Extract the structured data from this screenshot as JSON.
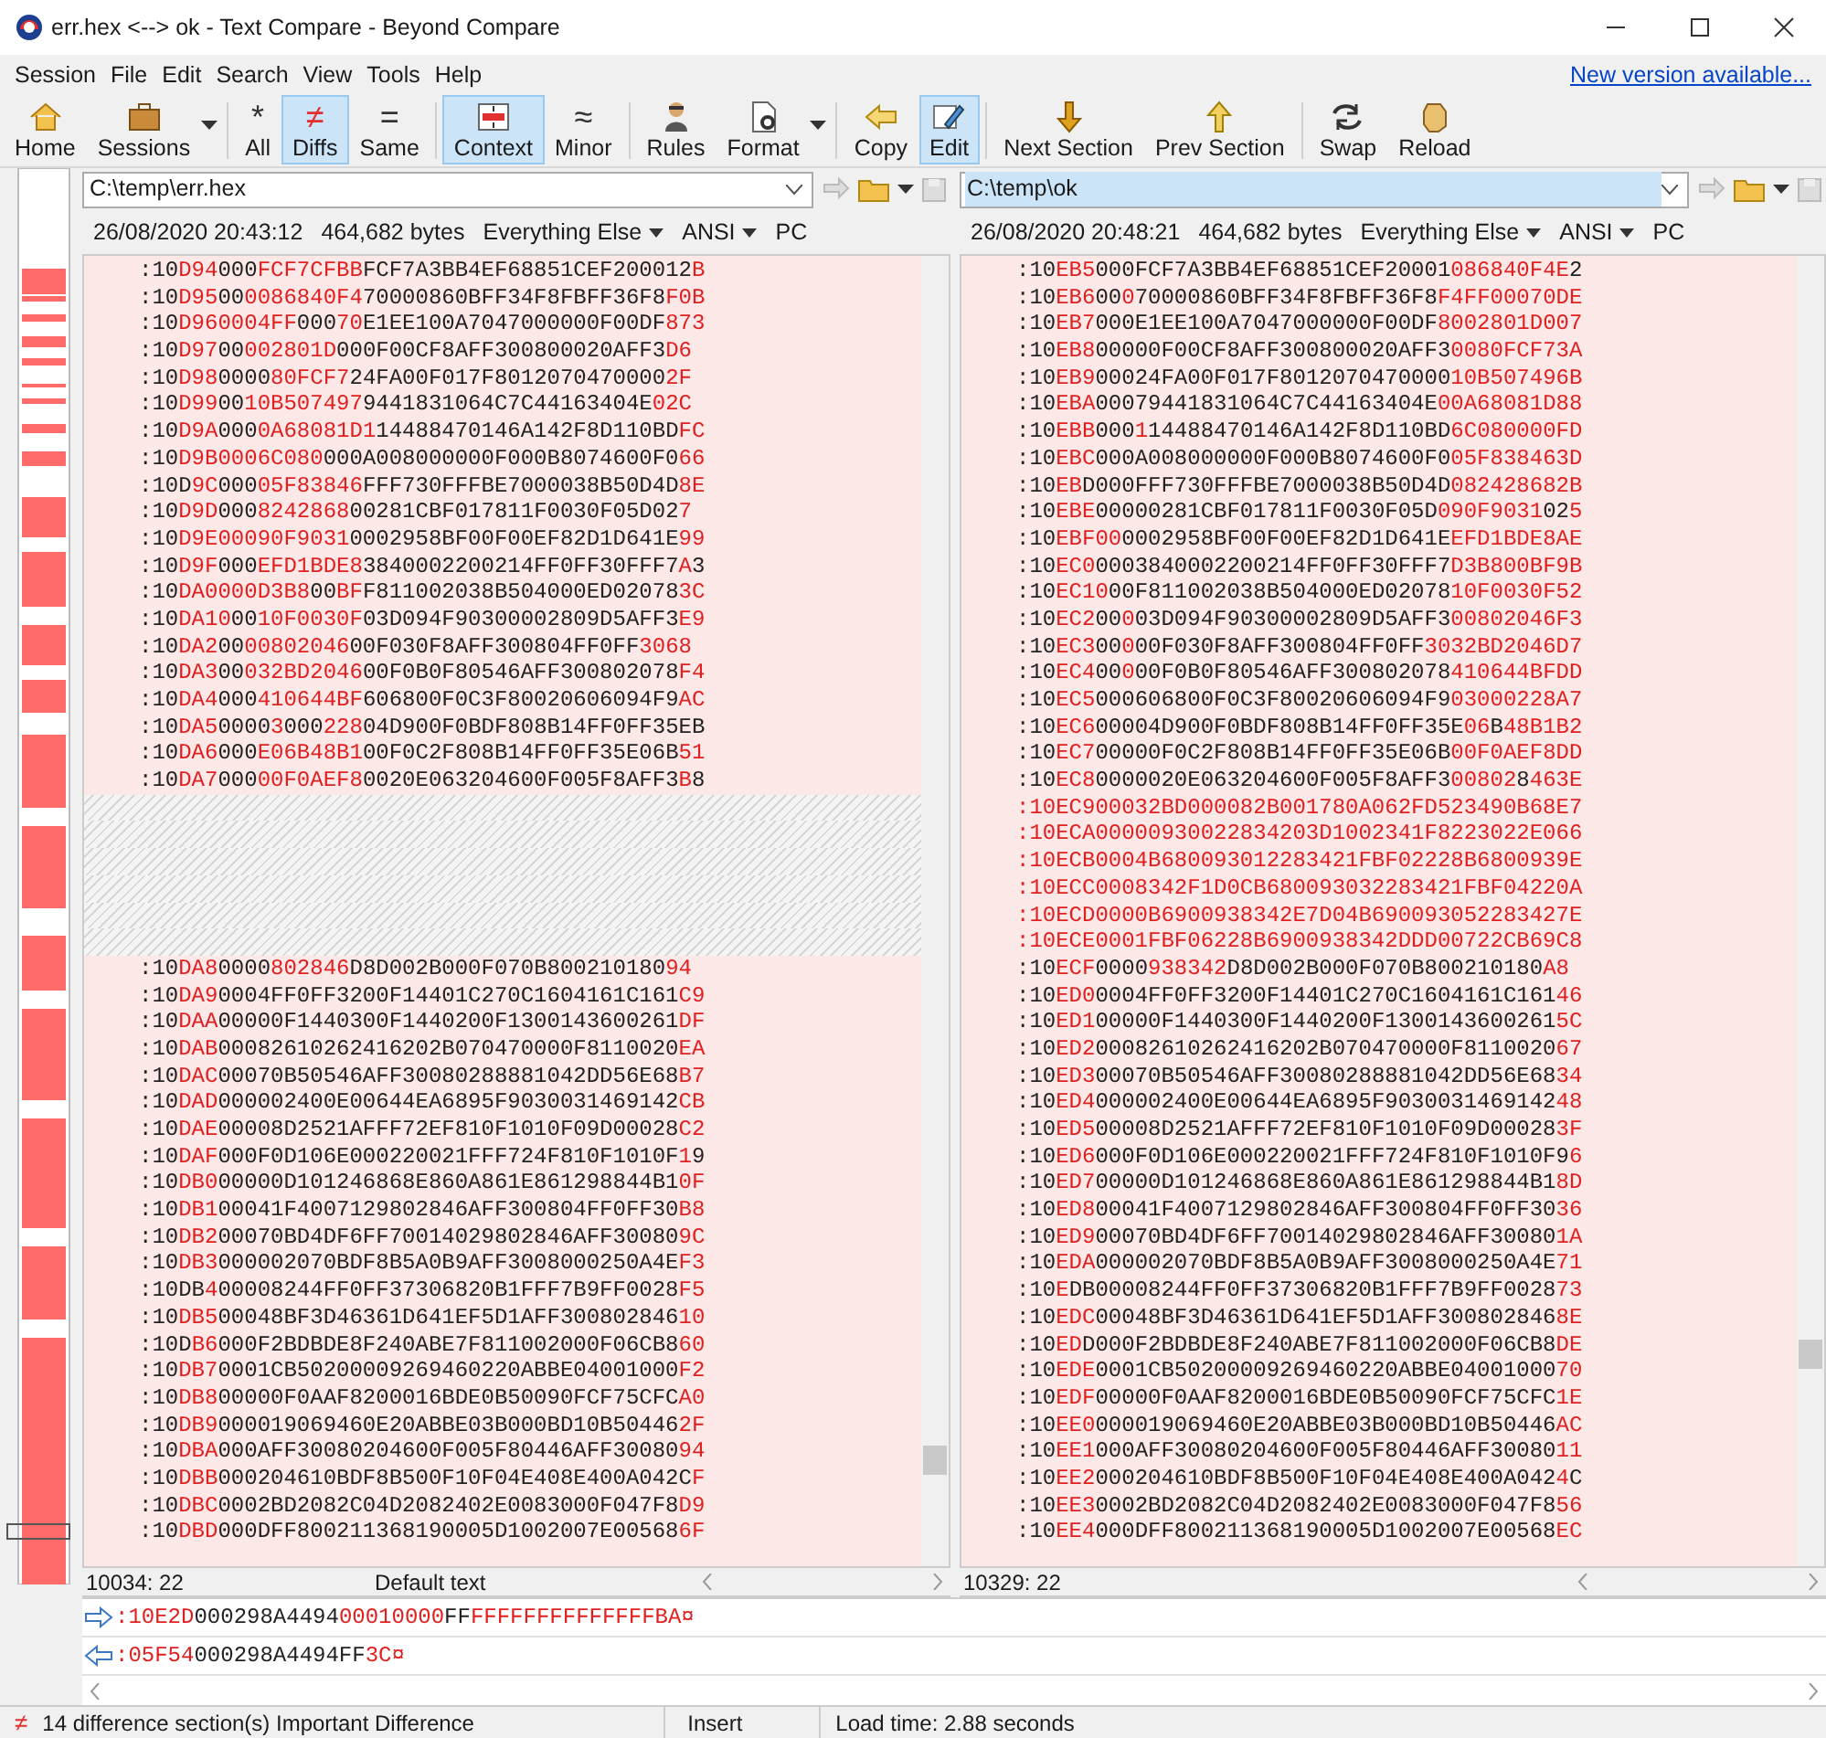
{
  "window": {
    "title": "err.hex <--> ok - Text Compare - Beyond Compare"
  },
  "menu": [
    "Session",
    "File",
    "Edit",
    "Search",
    "View",
    "Tools",
    "Help"
  ],
  "update_link": "New version available...",
  "toolbar": [
    {
      "label": "Home",
      "selected": false,
      "dropdown": false
    },
    {
      "label": "Sessions",
      "selected": false,
      "dropdown": true
    },
    {
      "label": "All",
      "glyph": "*",
      "selected": false,
      "dropdown": false
    },
    {
      "label": "Diffs",
      "glyph": "≠",
      "selected": true,
      "dropdown": false
    },
    {
      "label": "Same",
      "glyph": "=",
      "selected": false,
      "dropdown": false
    },
    {
      "label": "Context",
      "selected": true,
      "dropdown": false
    },
    {
      "label": "Minor",
      "glyph": "≈",
      "selected": false,
      "dropdown": false
    },
    {
      "label": "Rules",
      "selected": false,
      "dropdown": false
    },
    {
      "label": "Format",
      "selected": false,
      "dropdown": true
    },
    {
      "label": "Copy",
      "selected": false,
      "dropdown": false
    },
    {
      "label": "Edit",
      "selected": true,
      "dropdown": false
    },
    {
      "label": "Next Section",
      "selected": false,
      "dropdown": false
    },
    {
      "label": "Prev Section",
      "selected": false,
      "dropdown": false
    },
    {
      "label": "Swap",
      "selected": false,
      "dropdown": false
    },
    {
      "label": "Reload",
      "selected": false,
      "dropdown": false
    }
  ],
  "panes": [
    {
      "path": "C:\\temp\\err.hex",
      "highlighted": false,
      "timestamp": "26/08/2020 20:43:12",
      "size": "464,682 bytes",
      "format": "Everything Else",
      "encoding": "ANSI",
      "line_endings": "PC",
      "position": "10034: 22",
      "mode": "Default text",
      "lines": [
        {
          "kind": "mixed",
          "parts": [
            ":10",
            "D94",
            "000",
            "FCF7CFBB",
            "FCF7A3BB4EF68851CEF200012",
            "B"
          ]
        },
        {
          "kind": "mixed",
          "parts": [
            ":10",
            "D95",
            "00",
            "0086840F4",
            "70000860BFF34F8FBFF36F8",
            "F0B"
          ]
        },
        {
          "kind": "mixed",
          "parts": [
            ":10",
            "D960004FF",
            "000",
            "70",
            "E1EE100A7047000000F00DF",
            "873"
          ]
        },
        {
          "kind": "mixed",
          "parts": [
            ":10",
            "D97",
            "00",
            "002801D",
            "000F00CF8AFF300800020AFF3",
            "D6"
          ]
        },
        {
          "kind": "mixed",
          "parts": [
            ":10",
            "D98",
            "0000",
            "80FCF7",
            "24FA00F017F8012070470000",
            "2F"
          ]
        },
        {
          "kind": "mixed",
          "parts": [
            ":10",
            "D99",
            "00",
            "10B507497",
            "9441831064C7C44163404E",
            "02C"
          ]
        },
        {
          "kind": "mixed",
          "parts": [
            ":10",
            "D9A",
            "000",
            "0A68081D1",
            "14488470146A142F8D110BD",
            "FC"
          ]
        },
        {
          "kind": "mixed",
          "parts": [
            ":10",
            "D9B0006C080",
            "000A008000000F000B8074600F0",
            "66"
          ]
        },
        {
          "kind": "mixed",
          "parts": [
            ":10D",
            "9C",
            "000",
            "05F83846",
            "FFF730FFFBE7000038B50D4D",
            "8E"
          ]
        },
        {
          "kind": "mixed",
          "parts": [
            ":10",
            "D9D",
            "000",
            "8242868",
            "00281CBF017811F0030F05D02",
            "7"
          ]
        },
        {
          "kind": "mixed",
          "parts": [
            ":10",
            "D9E00090F9031",
            "0002958BF00F00EF82D1D641E",
            "99"
          ]
        },
        {
          "kind": "mixed",
          "parts": [
            ":10",
            "D9F",
            "000",
            "EFD1BDE8",
            "3840002200214FF0FF30FFF7",
            "A",
            "3"
          ]
        },
        {
          "kind": "mixed",
          "parts": [
            ":10",
            "DA0000D3B8",
            "00",
            "BF",
            "F811002038B504000ED02078",
            "3C"
          ]
        },
        {
          "kind": "mixed",
          "parts": [
            ":10",
            "DA10",
            "00",
            "10F0030F",
            "03D094F90300002809D5AFF3",
            "E9"
          ]
        },
        {
          "kind": "mixed",
          "parts": [
            ":10",
            "DA2",
            "00",
            "00802046",
            "00F030F8AFF300804FF0FF",
            "3068"
          ]
        },
        {
          "kind": "mixed",
          "parts": [
            ":10",
            "DA3",
            "00",
            "032BD2046",
            "00F0B0F80546AFF300802078",
            "F4"
          ]
        },
        {
          "kind": "mixed",
          "parts": [
            ":10",
            "DA4",
            "000",
            "410644BF",
            "606800F0C3F80020606094F9",
            "AC"
          ]
        },
        {
          "kind": "mixed",
          "parts": [
            ":10",
            "DA5",
            "0000",
            "3",
            "000",
            "228",
            "04D900F0BDF808B14FF0FF35EB"
          ]
        },
        {
          "kind": "mixed",
          "parts": [
            ":10",
            "DA6",
            "000",
            "E06B48B1",
            "00F0C2F808B14FF0FF35E06B",
            "51"
          ]
        },
        {
          "kind": "mixed",
          "parts": [
            ":10",
            "DA7",
            "000",
            "00F0AEF8",
            "0020E063204600F005F8AFF3",
            "B",
            "8"
          ]
        },
        {
          "kind": "missing"
        },
        {
          "kind": "missing"
        },
        {
          "kind": "missing"
        },
        {
          "kind": "missing"
        },
        {
          "kind": "missing"
        },
        {
          "kind": "missing"
        },
        {
          "kind": "mixed",
          "parts": [
            ":10",
            "DA8",
            "0000",
            "802846",
            "D8D002B000F070B800210180",
            "94"
          ]
        },
        {
          "kind": "mixed",
          "parts": [
            ":10",
            "DA9",
            "0004FF0FF3200F14401C270C1604161C161",
            "C9"
          ]
        },
        {
          "kind": "mixed",
          "parts": [
            ":10",
            "DAA",
            "00000F1440300F1440200F1300143600261",
            "DF"
          ]
        },
        {
          "kind": "mixed",
          "parts": [
            ":10",
            "DAB",
            "00082610262416202B070470000F8110020",
            "EA"
          ]
        },
        {
          "kind": "mixed",
          "parts": [
            ":10",
            "DAC",
            "00070B50546AFF30080288881042DD56E68",
            "B7"
          ]
        },
        {
          "kind": "mixed",
          "parts": [
            ":10",
            "DAD",
            "000002400E00644EA6895F9030031469142",
            "CB"
          ]
        },
        {
          "kind": "mixed",
          "parts": [
            ":10",
            "DAE",
            "00008D2521AFFF72EF810F1010F09D00028",
            "C2"
          ]
        },
        {
          "kind": "mixed",
          "parts": [
            ":10",
            "DAF",
            "000F0D106E000220021FFF724F810F1010F",
            "1",
            "9"
          ]
        },
        {
          "kind": "mixed",
          "parts": [
            ":10",
            "DB0",
            "00000D101246868E860A861E861298844B1",
            "0F"
          ]
        },
        {
          "kind": "mixed",
          "parts": [
            ":10",
            "DB1",
            "00041F4007129802846AFF300804FF0FF30",
            "B8"
          ]
        },
        {
          "kind": "mixed",
          "parts": [
            ":10",
            "DB2",
            "00070BD4DF6FF70014029802846AFF30080",
            "9C"
          ]
        },
        {
          "kind": "mixed",
          "parts": [
            ":10",
            "DB3",
            "000002070BDF8B5A0B9AFF3008000250A4E",
            "F3"
          ]
        },
        {
          "kind": "mixed",
          "parts": [
            ":10DB",
            "4",
            "00008244FF0FF37306820B1FFF7B9FF0028",
            "F5"
          ]
        },
        {
          "kind": "mixed",
          "parts": [
            ":10",
            "DB5",
            "00048BF3D46361D641EF5D1AFF300802846",
            "10"
          ]
        },
        {
          "kind": "mixed",
          "parts": [
            ":10D",
            "B6",
            "000F2BDBDE8F240ABE7F811002000F06CB8",
            "60"
          ]
        },
        {
          "kind": "mixed",
          "parts": [
            ":10",
            "DB7",
            "0001CB50200009269460220ABBE04001000",
            "F2"
          ]
        },
        {
          "kind": "mixed",
          "parts": [
            ":10",
            "DB8",
            "00000F0AAF8200016BDE0B50090FCF75CFC",
            "A0"
          ]
        },
        {
          "kind": "mixed",
          "parts": [
            ":10",
            "DB9",
            "000019069460E20ABBE03B000BD10B50446",
            "2F"
          ]
        },
        {
          "kind": "mixed",
          "parts": [
            ":10",
            "DBA",
            "000AFF30080204600F005F80446AFF30080",
            "94"
          ]
        },
        {
          "kind": "mixed",
          "parts": [
            ":10",
            "DBB",
            "000204610BDF8B500F10F04E408E400A042C",
            "F"
          ]
        },
        {
          "kind": "mixed",
          "parts": [
            ":10",
            "DBC",
            "0002BD2082C04D2082402E0083000F047F8",
            "D9"
          ]
        },
        {
          "kind": "mixed",
          "parts": [
            ":10",
            "DBD",
            "000DFF800211368190005D1002007E00568",
            "6F"
          ]
        }
      ]
    },
    {
      "path": "C:\\temp\\ok",
      "highlighted": true,
      "timestamp": "26/08/2020 20:48:21",
      "size": "464,682 bytes",
      "format": "Everything Else",
      "encoding": "ANSI",
      "line_endings": "PC",
      "position": "10329: 22",
      "lines": [
        {
          "kind": "mixed",
          "parts": [
            ":10",
            "EB5",
            "000FCF7A3BB4EF68851CEF20001",
            "086840F4E",
            "2"
          ]
        },
        {
          "kind": "mixed",
          "parts": [
            ":10",
            "EB6",
            "00",
            "0",
            "70000860BFF34F8FBFF36F8",
            "F4FF00070DE"
          ]
        },
        {
          "kind": "mixed",
          "parts": [
            ":10",
            "EB7",
            "000E1EE100A7047000000F00DF",
            "8002801D007"
          ]
        },
        {
          "kind": "mixed",
          "parts": [
            ":10",
            "EB8",
            "00000F00CF8AFF300800020AFF3",
            "0080FCF73A"
          ]
        },
        {
          "kind": "mixed",
          "parts": [
            ":10",
            "EB9",
            "00024FA00F017F8012070470000",
            "10B507496B"
          ]
        },
        {
          "kind": "mixed",
          "parts": [
            ":10",
            "EBA",
            "00079441831064C7C44163404E",
            "00A68081D88"
          ]
        },
        {
          "kind": "mixed",
          "parts": [
            ":10",
            "EBB",
            "000",
            "1",
            "14488470146A142F8D110BD",
            "6C080000FD"
          ]
        },
        {
          "kind": "mixed",
          "parts": [
            ":10",
            "EBC",
            "000A008000000F000B8074600F0",
            "05F838463D"
          ]
        },
        {
          "kind": "mixed",
          "parts": [
            ":10",
            "EB",
            "D000FFF730FFFBE7000038B50D4D",
            "082428682B"
          ]
        },
        {
          "kind": "mixed",
          "parts": [
            ":10",
            "EBE",
            "00000281CBF017811F0030F05D",
            "090F9031",
            "02",
            "5"
          ]
        },
        {
          "kind": "mixed",
          "parts": [
            ":10",
            "EBF00",
            "0002958BF00F00EF82D1D641E",
            "EFD1BDE8AE"
          ]
        },
        {
          "kind": "mixed",
          "parts": [
            ":10",
            "EC0",
            "0003840002200214FF0FF30FFF7",
            "D3B800BF9B"
          ]
        },
        {
          "kind": "mixed",
          "parts": [
            ":10",
            "EC10",
            "00F811002038B504000ED02078",
            "10F0030F52"
          ]
        },
        {
          "kind": "mixed",
          "parts": [
            ":10",
            "EC2",
            "00",
            "0",
            "03D094F90300002809D5AFF3",
            "00802046F3"
          ]
        },
        {
          "kind": "mixed",
          "parts": [
            ":10",
            "EC3",
            "00",
            "0",
            "00F030F8AFF300804FF0FF",
            "3032BD2046D7"
          ]
        },
        {
          "kind": "mixed",
          "parts": [
            ":10",
            "EC4",
            "00",
            "0",
            "00F0B0F80546AFF300802078",
            "410644BFDD"
          ]
        },
        {
          "kind": "mixed",
          "parts": [
            ":10",
            "EC5",
            "000606800F0C3F80020606094F9",
            "03000228A7"
          ]
        },
        {
          "kind": "mixed",
          "parts": [
            ":10",
            "EC6",
            "00004D900F0BDF808B14FF0FF35E",
            "06",
            "B",
            "48B1B2"
          ]
        },
        {
          "kind": "mixed",
          "parts": [
            ":10",
            "EC7",
            "00000F0C2F808B14FF0FF35E06B",
            "00F0AEF8DD"
          ]
        },
        {
          "kind": "mixed",
          "parts": [
            ":10",
            "EC8",
            "0000020E063204600F005F8AFF3",
            "00802",
            "8",
            "463E"
          ]
        },
        {
          "kind": "changed",
          "text": ":10EC900032BD000082B001780A062FD523490B68E7"
        },
        {
          "kind": "changed",
          "text": ":10ECA00000930022834203D1002341F8223022E066"
        },
        {
          "kind": "changed",
          "text": ":10ECB0004B680093012283421FBF02228B6800939E"
        },
        {
          "kind": "changed",
          "text": ":10ECC0008342F1D0CB680093032283421FBF04220A"
        },
        {
          "kind": "changed",
          "text": ":10ECD0000B6900938342E7D04B690093052283427E"
        },
        {
          "kind": "changed",
          "text": ":10ECE0001FBF06228B6900938342DDD00722CB69C8"
        },
        {
          "kind": "mixed",
          "parts": [
            ":10",
            "ECF",
            "0000",
            "938342",
            "D8D002B000F070B800210180",
            "A8"
          ]
        },
        {
          "kind": "mixed",
          "parts": [
            ":10",
            "ED0",
            "0004FF0FF3200F14401C270C1604161C161",
            "46"
          ]
        },
        {
          "kind": "mixed",
          "parts": [
            ":10",
            "ED1",
            "00000F1440300F1440200F1300143600261",
            "5C"
          ]
        },
        {
          "kind": "mixed",
          "parts": [
            ":10",
            "ED2",
            "00082610262416202B070470000F8110020",
            "67"
          ]
        },
        {
          "kind": "mixed",
          "parts": [
            ":10",
            "ED3",
            "00070B50546AFF30080288881042DD56E68",
            "34"
          ]
        },
        {
          "kind": "mixed",
          "parts": [
            ":10",
            "ED4",
            "000002400E00644EA6895F9030031469142",
            "48"
          ]
        },
        {
          "kind": "mixed",
          "parts": [
            ":10",
            "ED5",
            "00008D2521AFFF72EF810F1010F09D00028",
            "3F"
          ]
        },
        {
          "kind": "mixed",
          "parts": [
            ":10",
            "ED6",
            "000F0D106E000220021FFF724F810F1010F9",
            "6"
          ]
        },
        {
          "kind": "mixed",
          "parts": [
            ":10",
            "ED7",
            "00000D101246868E860A861E861298844B1",
            "8D"
          ]
        },
        {
          "kind": "mixed",
          "parts": [
            ":10",
            "ED8",
            "00041F4007129802846AFF300804FF0FF30",
            "36"
          ]
        },
        {
          "kind": "mixed",
          "parts": [
            ":10",
            "ED9",
            "00070BD4DF6FF70014029802846AFF30080",
            "1A"
          ]
        },
        {
          "kind": "mixed",
          "parts": [
            ":10",
            "EDA",
            "000002070BDF8B5A0B9AFF3008000250A4E",
            "71"
          ]
        },
        {
          "kind": "mixed",
          "parts": [
            ":10",
            "E",
            "DB00008244FF0FF37306820B1FFF7B9FF0028",
            "73"
          ]
        },
        {
          "kind": "mixed",
          "parts": [
            ":10",
            "EDC",
            "00048BF3D46361D641EF5D1AFF300802846",
            "8E"
          ]
        },
        {
          "kind": "mixed",
          "parts": [
            ":10",
            "ED",
            "D000F2BDBDE8F240ABE7F811002000F06CB8",
            "DE"
          ]
        },
        {
          "kind": "mixed",
          "parts": [
            ":10",
            "EDE",
            "0001CB50200009269460220ABBE04001000",
            "70"
          ]
        },
        {
          "kind": "mixed",
          "parts": [
            ":10",
            "EDF",
            "00000F0AAF8200016BDE0B50090FCF75CFC",
            "1E"
          ]
        },
        {
          "kind": "mixed",
          "parts": [
            ":10",
            "EE0",
            "000019069460E20ABBE03B000BD10B50446",
            "AC"
          ]
        },
        {
          "kind": "mixed",
          "parts": [
            ":10",
            "EE1",
            "000AFF30080204600F005F80446AFF30080",
            "11"
          ]
        },
        {
          "kind": "mixed",
          "parts": [
            ":10",
            "EE2",
            "000204610BDF8B500F10F04E408E400A042",
            "4",
            "C"
          ]
        },
        {
          "kind": "mixed",
          "parts": [
            ":10",
            "EE3",
            "0002BD2082C04D2082402E0083000F047F8",
            "56"
          ]
        },
        {
          "kind": "mixed",
          "parts": [
            ":10",
            "EE4",
            "000DFF800211368190005D1002007E00568",
            "EC"
          ]
        }
      ]
    }
  ],
  "line_compare": [
    {
      "segments": [
        {
          "text": ":10E2D",
          "diff": true
        },
        {
          "text": "000298A4494",
          "diff": false
        },
        {
          "text": "00010000",
          "diff": true
        },
        {
          "text": "FF",
          "diff": false
        },
        {
          "text": "FFFFFFFFFFFFFFBA¤",
          "diff": true
        }
      ]
    },
    {
      "segments": [
        {
          "text": ":05F54",
          "diff": true
        },
        {
          "text": "000298A4494FF",
          "diff": false
        },
        {
          "text": "3C¤",
          "diff": true
        }
      ]
    }
  ],
  "status_bar": {
    "glyph": "≠",
    "summary": "14 difference section(s) Important Difference",
    "mode": "Insert",
    "load_time": "Load time: 2.88 seconds"
  }
}
